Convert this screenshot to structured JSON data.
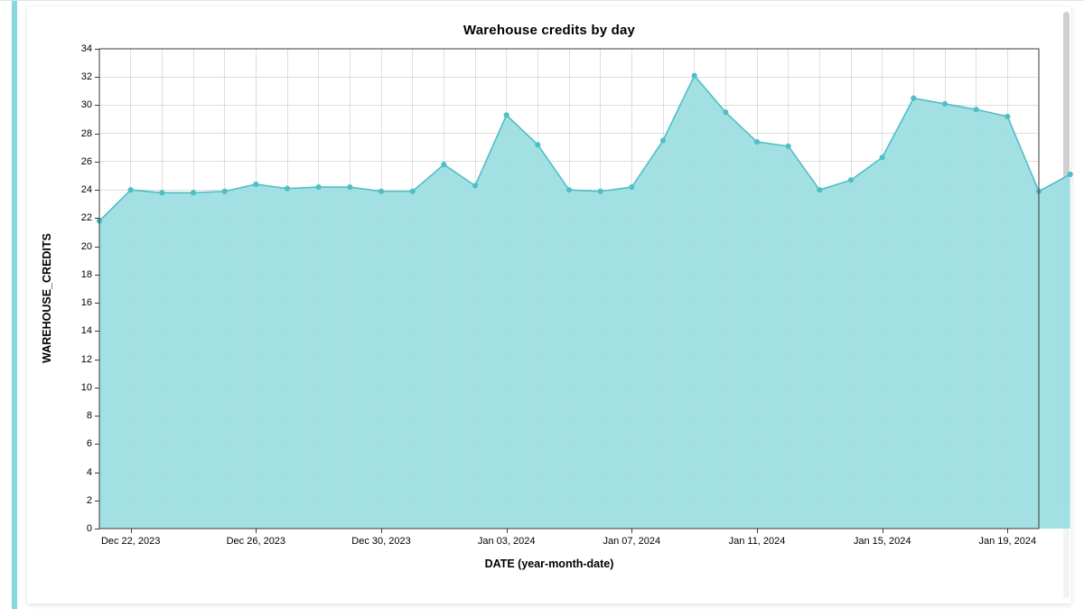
{
  "chart_data": {
    "type": "area",
    "title": "Warehouse credits by day",
    "xlabel": "DATE (year-month-date)",
    "ylabel": "WAREHOUSE_CREDITS",
    "ylim": [
      0,
      34
    ],
    "y_ticks": [
      0,
      2,
      4,
      6,
      8,
      10,
      12,
      14,
      16,
      18,
      20,
      22,
      24,
      26,
      28,
      30,
      32,
      34
    ],
    "x_tick_labels": [
      "Dec 22, 2023",
      "Dec 26, 2023",
      "Dec 30, 2023",
      "Jan 03, 2024",
      "Jan 07, 2024",
      "Jan 11, 2024",
      "Jan 15, 2024",
      "Jan 19, 2024"
    ],
    "x_tick_indices": [
      1,
      5,
      9,
      13,
      17,
      21,
      25,
      29
    ],
    "categories": [
      "Dec 21, 2023",
      "Dec 22, 2023",
      "Dec 23, 2023",
      "Dec 24, 2023",
      "Dec 25, 2023",
      "Dec 26, 2023",
      "Dec 27, 2023",
      "Dec 28, 2023",
      "Dec 29, 2023",
      "Dec 30, 2023",
      "Dec 31, 2023",
      "Jan 01, 2024",
      "Jan 02, 2024",
      "Jan 03, 2024",
      "Jan 04, 2024",
      "Jan 05, 2024",
      "Jan 06, 2024",
      "Jan 07, 2024",
      "Jan 08, 2024",
      "Jan 09, 2024",
      "Jan 10, 2024",
      "Jan 11, 2024",
      "Jan 12, 2024",
      "Jan 13, 2024",
      "Jan 14, 2024",
      "Jan 15, 2024",
      "Jan 16, 2024",
      "Jan 17, 2024",
      "Jan 18, 2024",
      "Jan 19, 2024",
      "Jan 20, 2024"
    ],
    "values": [
      21.8,
      24.0,
      23.8,
      23.8,
      23.9,
      24.4,
      24.1,
      24.2,
      24.2,
      23.9,
      23.9,
      25.8,
      24.3,
      29.3,
      27.2,
      24.0,
      23.9,
      24.2,
      27.5,
      32.1,
      29.5,
      27.4,
      27.1,
      24.0,
      24.7,
      26.3,
      30.5,
      30.1,
      29.7,
      29.2,
      23.9
    ],
    "values_extra": 25.1,
    "colors": {
      "area": "#9edee2",
      "line": "#4fbfc6"
    }
  }
}
